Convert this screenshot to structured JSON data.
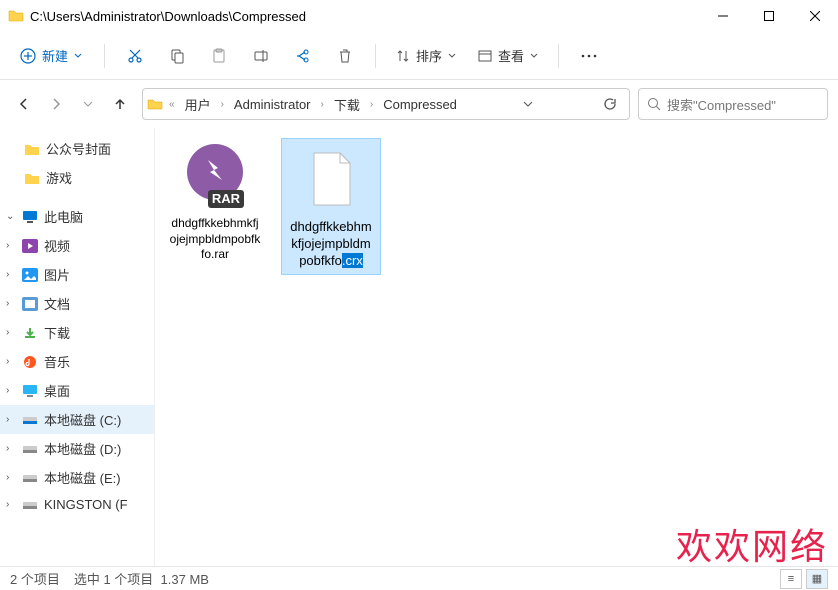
{
  "titlebar": {
    "path": "C:\\Users\\Administrator\\Downloads\\Compressed"
  },
  "toolbar": {
    "new_label": "新建",
    "sort_label": "排序",
    "view_label": "查看"
  },
  "breadcrumb": {
    "items": [
      "用户",
      "Administrator",
      "下载",
      "Compressed"
    ]
  },
  "search": {
    "placeholder": "搜索\"Compressed\""
  },
  "sidebar": {
    "quick": [
      {
        "label": "公众号封面"
      },
      {
        "label": "游戏"
      }
    ],
    "thispc_label": "此电脑",
    "thispc": [
      {
        "label": "视频"
      },
      {
        "label": "图片"
      },
      {
        "label": "文档"
      },
      {
        "label": "下载"
      },
      {
        "label": "音乐"
      },
      {
        "label": "桌面"
      },
      {
        "label": "本地磁盘 (C:)"
      },
      {
        "label": "本地磁盘 (D:)"
      },
      {
        "label": "本地磁盘 (E:)"
      },
      {
        "label": "KINGSTON (F"
      }
    ]
  },
  "files": [
    {
      "name": "dhdgffkkebhmkfjojejmpbldmpobfkfo.rar",
      "selected": false,
      "type": "rar"
    },
    {
      "name_base": "dhdgffkkebhmkfjojejmpbldmpobfkfo",
      "name_ext_sel": ".crx",
      "selected": true,
      "type": "blank"
    }
  ],
  "status": {
    "count": "2 个项目",
    "selection": "选中 1 个项目",
    "size": "1.37 MB"
  },
  "watermark": "欢欢网络"
}
